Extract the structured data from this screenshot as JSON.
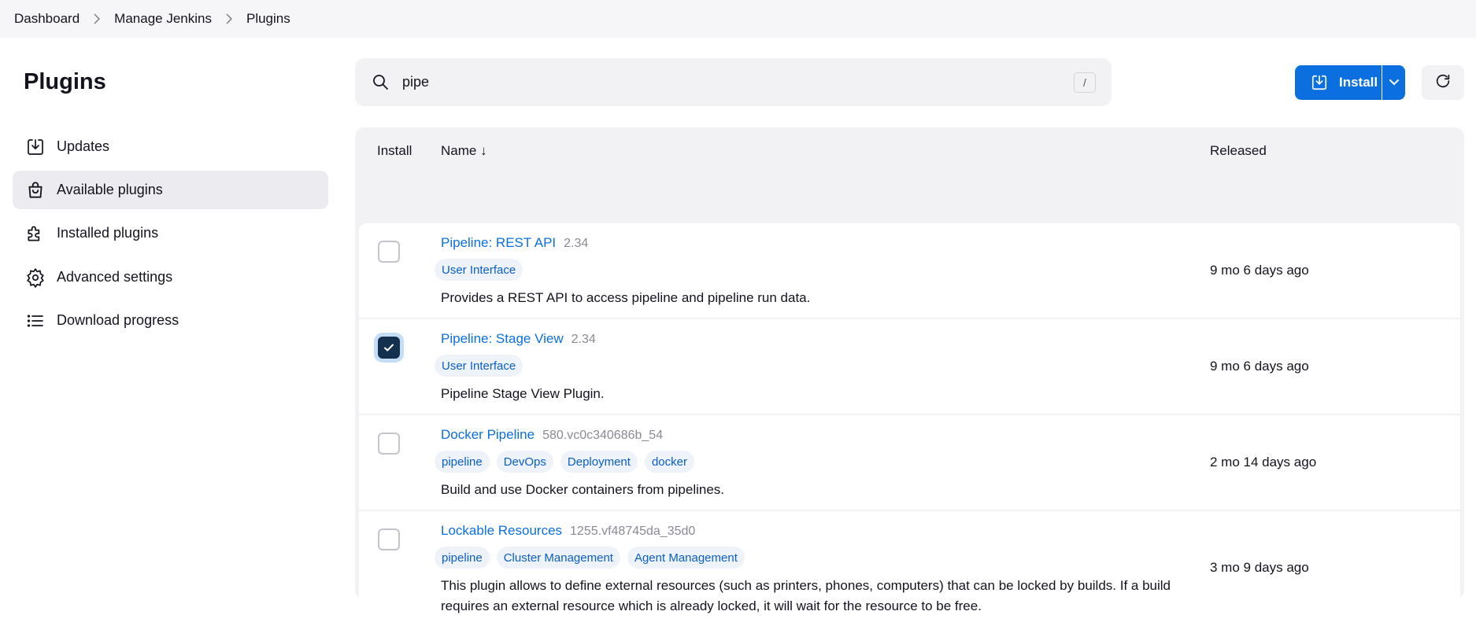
{
  "breadcrumb": [
    "Dashboard",
    "Manage Jenkins",
    "Plugins"
  ],
  "sidebar": {
    "title": "Plugins",
    "items": [
      {
        "label": "Updates",
        "icon": "download-icon",
        "active": false
      },
      {
        "label": "Available plugins",
        "icon": "shopping-bag-icon",
        "active": true
      },
      {
        "label": "Installed plugins",
        "icon": "puzzle-icon",
        "active": false
      },
      {
        "label": "Advanced settings",
        "icon": "gear-icon",
        "active": false
      },
      {
        "label": "Download progress",
        "icon": "list-icon",
        "active": false
      }
    ]
  },
  "search": {
    "value": "pipe",
    "shortcut": "/"
  },
  "toolbar": {
    "install_label": "Install"
  },
  "table": {
    "headers": {
      "install": "Install",
      "name": "Name ↓",
      "released": "Released"
    },
    "rows": [
      {
        "checked": false,
        "name": "Pipeline: REST API",
        "version": "2.34",
        "tags": [
          "User Interface"
        ],
        "description": "Provides a REST API to access pipeline and pipeline run data.",
        "released": "9 mo 6 days ago"
      },
      {
        "checked": true,
        "name": "Pipeline: Stage View",
        "version": "2.34",
        "tags": [
          "User Interface"
        ],
        "description": "Pipeline Stage View Plugin.",
        "released": "9 mo 6 days ago"
      },
      {
        "checked": false,
        "name": "Docker Pipeline",
        "version": "580.vc0c340686b_54",
        "tags": [
          "pipeline",
          "DevOps",
          "Deployment",
          "docker"
        ],
        "description": "Build and use Docker containers from pipelines.",
        "released": "2 mo 14 days ago"
      },
      {
        "checked": false,
        "name": "Lockable Resources",
        "version": "1255.vf48745da_35d0",
        "tags": [
          "pipeline",
          "Cluster Management",
          "Agent Management"
        ],
        "description": "This plugin allows to define external resources (such as printers, phones, computers) that can be locked by builds. If a build requires an external resource which is already locked, it will wait for the resource to be free.",
        "released": "3 mo 9 days ago"
      }
    ]
  },
  "colors": {
    "accent": "#0b6fe0",
    "checked": "#14304f",
    "tag_bg": "#eef2f9"
  }
}
